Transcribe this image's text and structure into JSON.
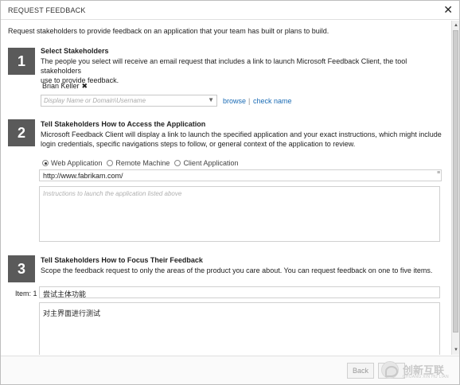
{
  "dialog": {
    "title": "REQUEST FEEDBACK",
    "close_icon": "close-icon"
  },
  "intro": "Request stakeholders to provide feedback on an application that your team has built or plans to build.",
  "step1": {
    "number": "1",
    "title": "Select Stakeholders",
    "desc_line1": "The people you select will receive an email request that includes a link to launch Microsoft Feedback Client, the tool stakeholders",
    "desc_line2": "use to provide feedback.",
    "selected_stakeholder": "Brian Keller",
    "remove_glyph": "✖",
    "input_placeholder": "Display Name or Domain\\Username",
    "browse_label": "browse",
    "link_separator": "|",
    "check_name_label": "check name"
  },
  "step2": {
    "number": "2",
    "title": "Tell Stakeholders How to Access the Application",
    "desc_line1": "Microsoft Feedback Client will display a link to launch the specified application and your exact instructions, which might include",
    "desc_line2": "login credentials, specific navigations steps to follow, or general context of the application to review.",
    "options": [
      "Web Application",
      "Remote Machine",
      "Client Application"
    ],
    "selected_option": "Web Application",
    "url_value": "http://www.fabrikam.com/",
    "instructions_placeholder": "Instructions to launch the application listed above"
  },
  "step3": {
    "number": "3",
    "title": "Tell Stakeholders How to Focus Their Feedback",
    "desc_line1": "Scope the feedback request to only the areas of the product you care about. You can request feedback on one to five items.",
    "item_label": "Item: 1",
    "item_title_value": "尝试主体功能",
    "item_detail_value": "对主界面进行测试"
  },
  "footer": {
    "back_label": "Back",
    "watermark_text": "创新互联",
    "watermark_sub": "CHUANG XIN HU LIAN"
  },
  "colors": {
    "accent_link": "#1a6bb5",
    "step_badge": "#5a5a5a"
  }
}
